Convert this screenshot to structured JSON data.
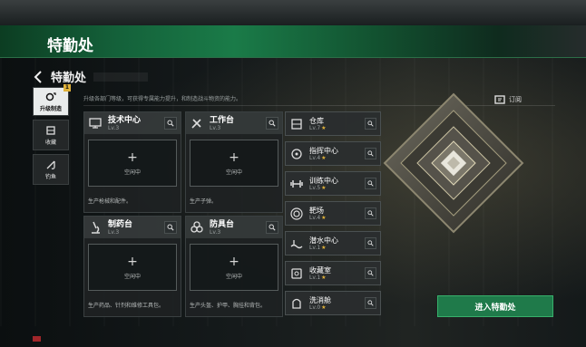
{
  "header": {
    "title": "特勤处"
  },
  "subheader": {
    "title": "特勤处"
  },
  "description": "升级各部门等级，可获得专属能力提升，和制造战斗物资的能力。",
  "subscribe_label": "订阅",
  "side_tabs": [
    {
      "label": "升级制造",
      "badge": "1",
      "active": true,
      "icon": "upgrade-icon"
    },
    {
      "label": "收藏",
      "icon": "collection-icon"
    },
    {
      "label": "钓鱼",
      "icon": "fishing-icon"
    }
  ],
  "cards": [
    {
      "name": "技术中心",
      "level": "Lv.3",
      "idle": "空闲中",
      "desc": "生产枪械和配件。",
      "icon": "computer-icon"
    },
    {
      "name": "工作台",
      "level": "Lv.3",
      "idle": "空闲中",
      "desc": "生产子弹。",
      "icon": "tools-icon"
    },
    {
      "name": "制药台",
      "level": "Lv.3",
      "idle": "空闲中",
      "desc": "生产药品、针剂和维修工具包。",
      "icon": "microscope-icon"
    },
    {
      "name": "防具台",
      "level": "Lv.3",
      "idle": "空闲中",
      "desc": "生产头盔、护甲、胸挂和背包。",
      "icon": "armor-icon"
    }
  ],
  "rooms": [
    {
      "name": "仓库",
      "level": "Lv.7",
      "icon": "warehouse-icon"
    },
    {
      "name": "指挥中心",
      "level": "Lv.4",
      "icon": "command-icon"
    },
    {
      "name": "训练中心",
      "level": "Lv.5",
      "icon": "dumbbell-icon"
    },
    {
      "name": "靶场",
      "level": "Lv.4",
      "icon": "target-icon"
    },
    {
      "name": "潜水中心",
      "level": "Lv.1",
      "icon": "dive-icon"
    },
    {
      "name": "收藏室",
      "level": "Lv.1",
      "icon": "collection-room-icon"
    },
    {
      "name": "洗消舱",
      "level": "Lv.0",
      "icon": "decon-icon"
    }
  ],
  "enter_button": "进入特勤处",
  "colors": {
    "accent": "#1f7a4a",
    "star": "#e0b23a",
    "banner": "#14613a"
  }
}
